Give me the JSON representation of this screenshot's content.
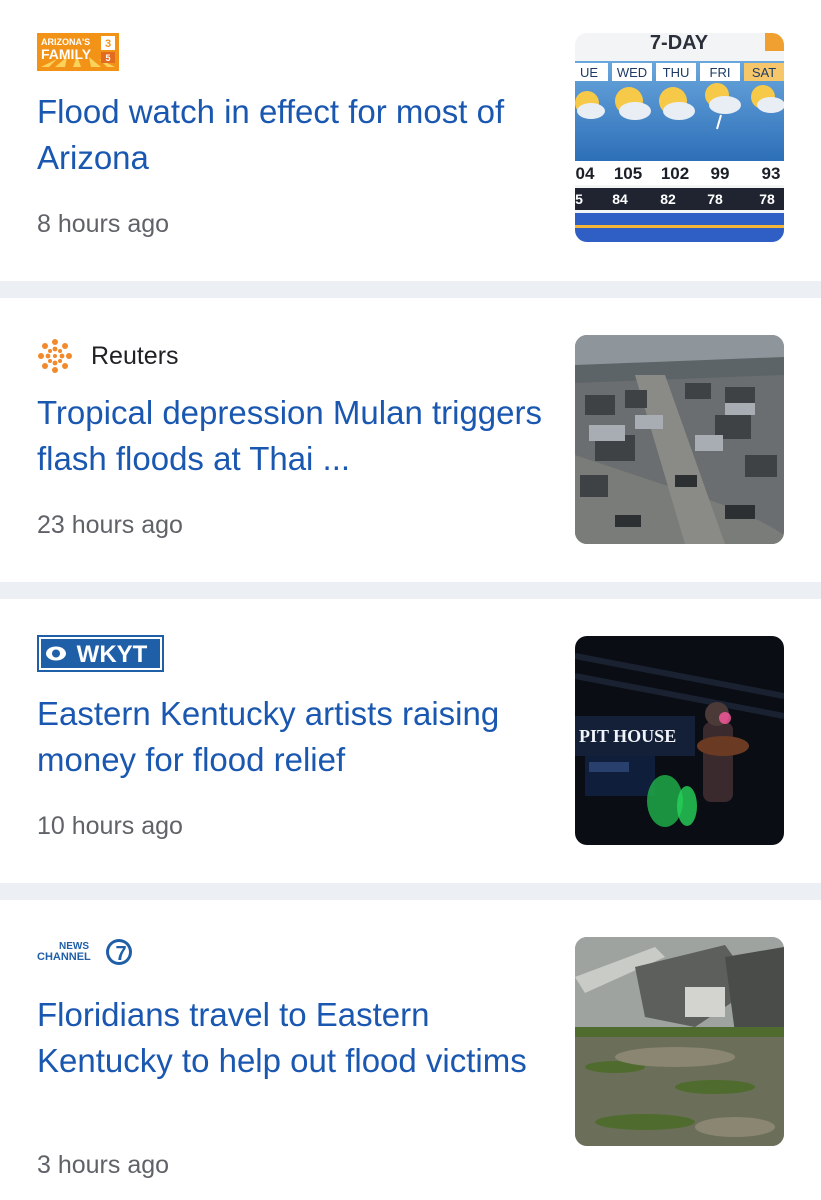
{
  "articles": [
    {
      "source": "ARIZONA'S FAMILY",
      "logo_badge": "3",
      "logo_sub": "5",
      "title": "Flood watch in effect for most of Arizona",
      "time": "8 hours ago",
      "forecast": {
        "heading": "7-DAY",
        "days": [
          "UE",
          "WED",
          "THU",
          "FRI",
          "SAT"
        ],
        "highs": [
          "04",
          "105",
          "102",
          "99",
          "93"
        ],
        "lows": [
          "5",
          "84",
          "82",
          "78",
          "78"
        ]
      }
    },
    {
      "source": "Reuters",
      "title": "Tropical depression Mulan triggers flash floods at Thai ...",
      "time": "23 hours ago"
    },
    {
      "source": "WKYT",
      "title": "Eastern Kentucky artists raising money for flood relief",
      "time": "10 hours ago",
      "sign_text": "PIT HOUSE"
    },
    {
      "source": "NEWS CHANNEL 7",
      "logo_line1": "NEWS",
      "logo_line2": "CHANNEL",
      "logo_badge": "7",
      "title": "Floridians travel to Eastern Kentucky to help out flood victims",
      "time": "3 hours ago"
    }
  ],
  "colors": {
    "title": "#1a57b0",
    "time": "#5f6368",
    "separator": "#eceff3",
    "az_orange": "#f29318",
    "wkyt_blue": "#1f5fa8"
  }
}
